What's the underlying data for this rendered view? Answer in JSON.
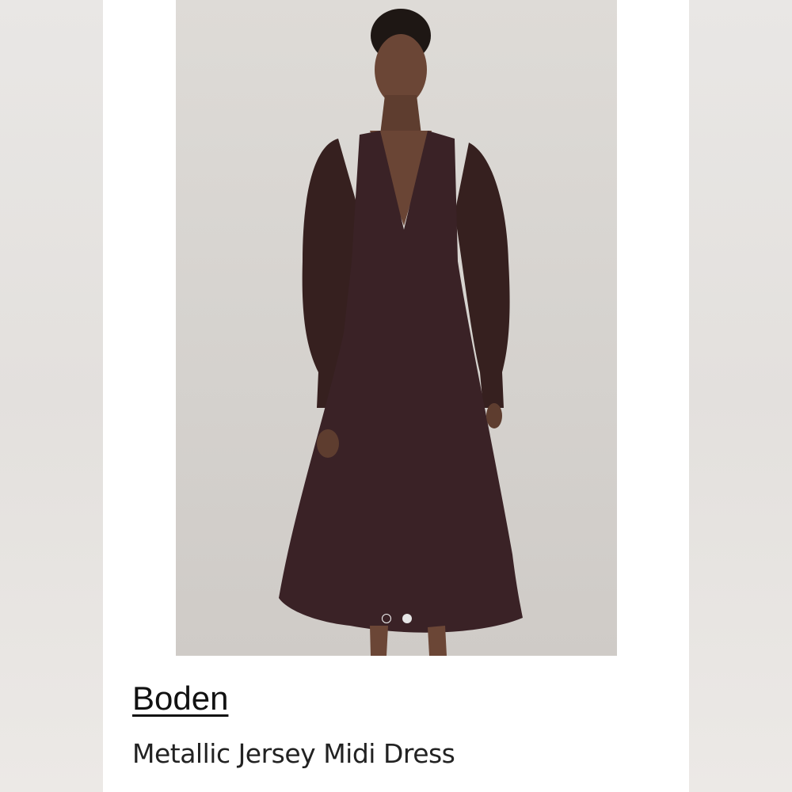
{
  "product": {
    "brand": "Boden",
    "title": "Metallic Jersey Midi Dress"
  },
  "carousel": {
    "slide_count": 2,
    "active_index": 1
  },
  "colors": {
    "dress": "#3a2226",
    "backdrop": "#d8d5d1",
    "text": "#111111"
  }
}
